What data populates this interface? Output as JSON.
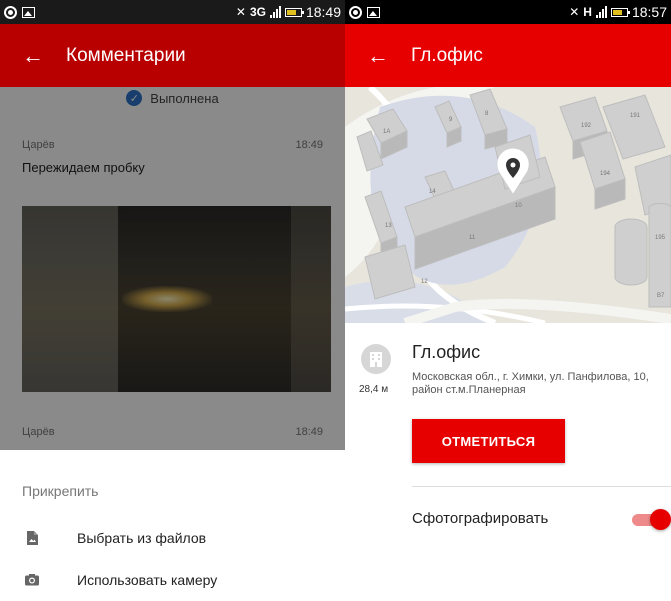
{
  "left": {
    "status_bar": {
      "network": "3G",
      "time": "18:49"
    },
    "app_bar": {
      "title": "Комментарии"
    },
    "status_label": "Выполнена",
    "comments": [
      {
        "author": "Царёв",
        "time": "18:49",
        "text": "Пережидаем пробку"
      },
      {
        "author": "Царёв",
        "time": "18:49"
      }
    ],
    "sheet": {
      "title": "Прикрепить",
      "items": [
        {
          "label": "Выбрать из файлов",
          "icon": "file-image-icon"
        },
        {
          "label": "Использовать камеру",
          "icon": "camera-icon"
        }
      ]
    }
  },
  "right": {
    "status_bar": {
      "network": "H",
      "time": "18:57"
    },
    "app_bar": {
      "title": "Гл.офис"
    },
    "map_labels": [
      "1A",
      "9",
      "8",
      "192",
      "191",
      "194",
      "14",
      "10",
      "13",
      "11",
      "12",
      "195",
      "B7"
    ],
    "place": {
      "title": "Гл.офис",
      "address": "Московская обл., г. Химки, ул. Панфилова, 10, район ст.м.Планерная",
      "distance": "28,4 м"
    },
    "check_in_button": "ОТМЕТИТЬСЯ",
    "photo_toggle": {
      "label": "Сфотографировать",
      "checked": true
    }
  },
  "colors": {
    "primary_red": "#e60000",
    "dimmed_red": "#b80000",
    "check_blue": "#2e73c9"
  }
}
